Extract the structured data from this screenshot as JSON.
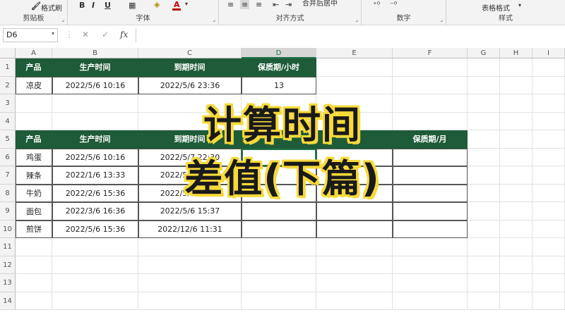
{
  "ribbon": {
    "clipboard": {
      "label": "剪贴板",
      "format_painter": "格式刷"
    },
    "font": {
      "label": "字体",
      "bold": "B",
      "italic": "I",
      "underline": "U"
    },
    "alignment": {
      "label": "对齐方式",
      "merge": "合并后居中"
    },
    "number": {
      "label": "数字"
    },
    "styles": {
      "label": "样式",
      "table_format": "表格格式"
    }
  },
  "formula_bar": {
    "name_box": "D6",
    "cancel": "✕",
    "enter": "✓",
    "fx": "fx",
    "value": ""
  },
  "columns": [
    "A",
    "B",
    "C",
    "D",
    "E",
    "F",
    "G",
    "H",
    "I"
  ],
  "selected_column": "D",
  "rows": [
    "1",
    "2",
    "3",
    "4",
    "5",
    "6",
    "7",
    "8",
    "9",
    "10",
    "11",
    "12",
    "13",
    "14"
  ],
  "table1": {
    "headers": [
      "产品",
      "生产时间",
      "到期时间",
      "保质期/小时"
    ],
    "rows": [
      [
        "凉皮",
        "2022/5/6 10:16",
        "2022/5/6 23:36",
        "13"
      ]
    ]
  },
  "table2": {
    "headers": [
      "产品",
      "生产时间",
      "到期时间",
      "",
      "",
      "保质期/月"
    ],
    "rows": [
      [
        "鸡蛋",
        "2022/5/6 10:16",
        "2022/5/7 22:30",
        "",
        "",
        ""
      ],
      [
        "辣条",
        "2022/1/6 13:33",
        "2022/5/6 13:33",
        "",
        "",
        ""
      ],
      [
        "牛奶",
        "2022/2/6 15:36",
        "2022/5/6 15:36",
        "",
        "",
        ""
      ],
      [
        "面包",
        "2022/3/6 16:36",
        "2022/5/6 15:37",
        "",
        "",
        ""
      ],
      [
        "煎饼",
        "2022/5/6 15:36",
        "2022/12/6 11:31",
        "",
        "",
        ""
      ]
    ]
  },
  "overlay": {
    "line1": "计算时间",
    "line2": "差值(下篇)",
    "text_color": "#1a1a1a",
    "outline_color": "#f6d93a"
  },
  "colors": {
    "header_green": "#1e5b39",
    "accent": "#217346"
  }
}
